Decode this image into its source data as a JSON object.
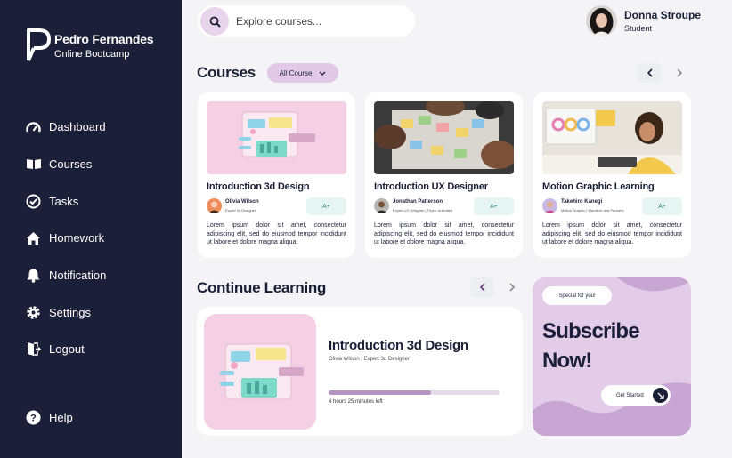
{
  "brand": {
    "name": "Pedro Fernandes",
    "subtitle": "Online Bootcamp"
  },
  "nav": {
    "items": [
      {
        "label": "Dashboard",
        "icon": "dashboard-icon"
      },
      {
        "label": "Courses",
        "icon": "book-icon"
      },
      {
        "label": "Tasks",
        "icon": "check-circle-icon"
      },
      {
        "label": "Homework",
        "icon": "home-icon"
      },
      {
        "label": "Notification",
        "icon": "bell-icon"
      },
      {
        "label": "Settings",
        "icon": "gear-icon"
      },
      {
        "label": "Logout",
        "icon": "logout-icon"
      }
    ],
    "help": "Help"
  },
  "search": {
    "placeholder": "Explore courses..."
  },
  "user": {
    "name": "Donna Stroupe",
    "role": "Student"
  },
  "courses": {
    "title": "Courses",
    "filter": "All Course",
    "cards": [
      {
        "title": "Introduction 3d Design",
        "author": "Olivia Wilson",
        "role": "Expert 3d Designer",
        "grade": "A+",
        "desc": "Lorem ipsum dolor sit amet, consectetur adipiscing elit, sed do eiusmod tempor incididunt ut labore et dolore magna aliqua."
      },
      {
        "title": "Introduction UX Designer",
        "author": "Jonathan Patterson",
        "role": "Expert UX Designer | Thynk Unlimited",
        "grade": "A+",
        "desc": "Lorem ipsum dolor sit amet, consectetur adipiscing elit, sed do eiusmod tempor incididunt ut labore et dolore magna aliqua."
      },
      {
        "title": "Motion Graphic Learning",
        "author": "Takehiro Kanegi",
        "role": "Motion Graphic | Wardiere and Partners",
        "grade": "A+",
        "desc": "Lorem ipsum dolor sit amet, consectetur adipiscing elit, sed do eiusmod tempor incididunt ut labore et dolore magna aliqua."
      }
    ]
  },
  "continue_learning": {
    "title": "Continue Learning",
    "course_title": "Introduction 3d Design",
    "author": "Olivia Wilson | Expert 3d Designer",
    "progress": 0.6,
    "time_left": "4 hours 25 minutes left"
  },
  "subscribe": {
    "badge": "Special for you!",
    "title_line1": "Subscribe",
    "title_line2": "Now!",
    "button": "Get Started"
  },
  "colors": {
    "sidebar": "#1b1f37",
    "accent": "#e1c9e6",
    "progress": "#b592bf",
    "grade_bg": "#e6f5f2"
  }
}
